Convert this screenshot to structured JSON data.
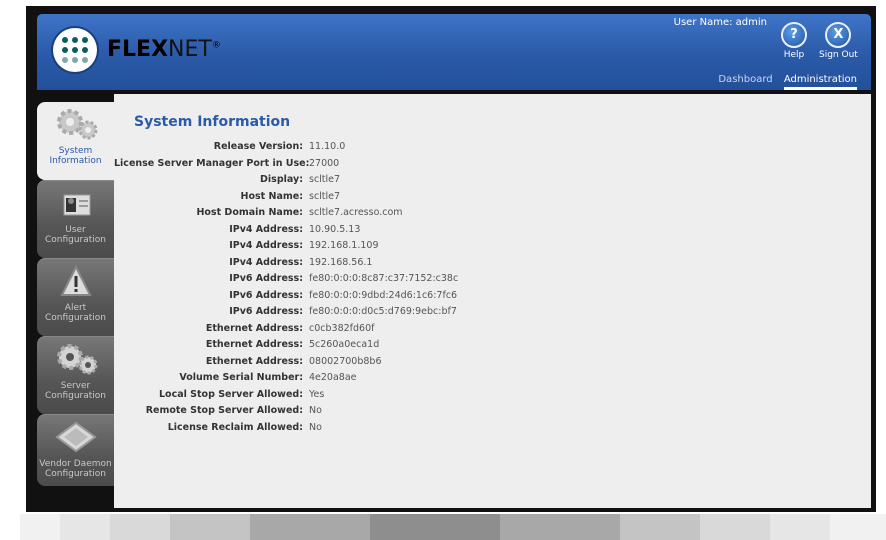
{
  "header": {
    "brand_bold": "FLEX",
    "brand_thin": "NET",
    "brand_mark": "®",
    "user_name": "User Name: admin",
    "help_label": "Help",
    "signout_label": "Sign Out",
    "help_glyph": "?",
    "signout_glyph": "X",
    "tabs": {
      "dashboard": "Dashboard",
      "administration": "Administration"
    }
  },
  "sidebar": {
    "items": [
      {
        "label": "System\nInformation",
        "icon": "gears-icon",
        "active": true
      },
      {
        "label": "User\nConfiguration",
        "icon": "user-badge-icon"
      },
      {
        "label": "Alert\nConfiguration",
        "icon": "warning-icon"
      },
      {
        "label": "Server\nConfiguration",
        "icon": "gears-icon"
      },
      {
        "label": "Vendor Daemon\nConfiguration",
        "icon": "license-card-icon"
      }
    ]
  },
  "main": {
    "title": "System Information",
    "rows": [
      {
        "k": "Release Version:",
        "v": "11.10.0"
      },
      {
        "k": "License Server Manager Port in Use:",
        "v": "27000"
      },
      {
        "k": "Display:",
        "v": "scltle7"
      },
      {
        "k": "Host Name:",
        "v": "scltle7"
      },
      {
        "k": "Host Domain Name:",
        "v": "scltle7.acresso.com"
      },
      {
        "k": "IPv4 Address:",
        "v": "10.90.5.13"
      },
      {
        "k": "IPv4 Address:",
        "v": "192.168.1.109"
      },
      {
        "k": "IPv4 Address:",
        "v": "192.168.56.1"
      },
      {
        "k": "IPv6 Address:",
        "v": "fe80:0:0:0:8c87:c37:7152:c38c"
      },
      {
        "k": "IPv6 Address:",
        "v": "fe80:0:0:0:9dbd:24d6:1c6:7fc6"
      },
      {
        "k": "IPv6 Address:",
        "v": "fe80:0:0:0:d0c5:d769:9ebc:bf7"
      },
      {
        "k": "Ethernet Address:",
        "v": "c0cb382fd60f"
      },
      {
        "k": "Ethernet Address:",
        "v": "5c260a0eca1d"
      },
      {
        "k": "Ethernet Address:",
        "v": "08002700b8b6"
      },
      {
        "k": "Volume Serial Number:",
        "v": "4e20a8ae"
      },
      {
        "k": "Local Stop Server Allowed:",
        "v": "Yes"
      },
      {
        "k": "Remote Stop Server Allowed:",
        "v": "No"
      },
      {
        "k": "License Reclaim Allowed:",
        "v": "No"
      }
    ]
  },
  "colors": {
    "accent": "#2a5aa8",
    "sidebar": "#555555",
    "content_bg": "#eeeeee"
  }
}
